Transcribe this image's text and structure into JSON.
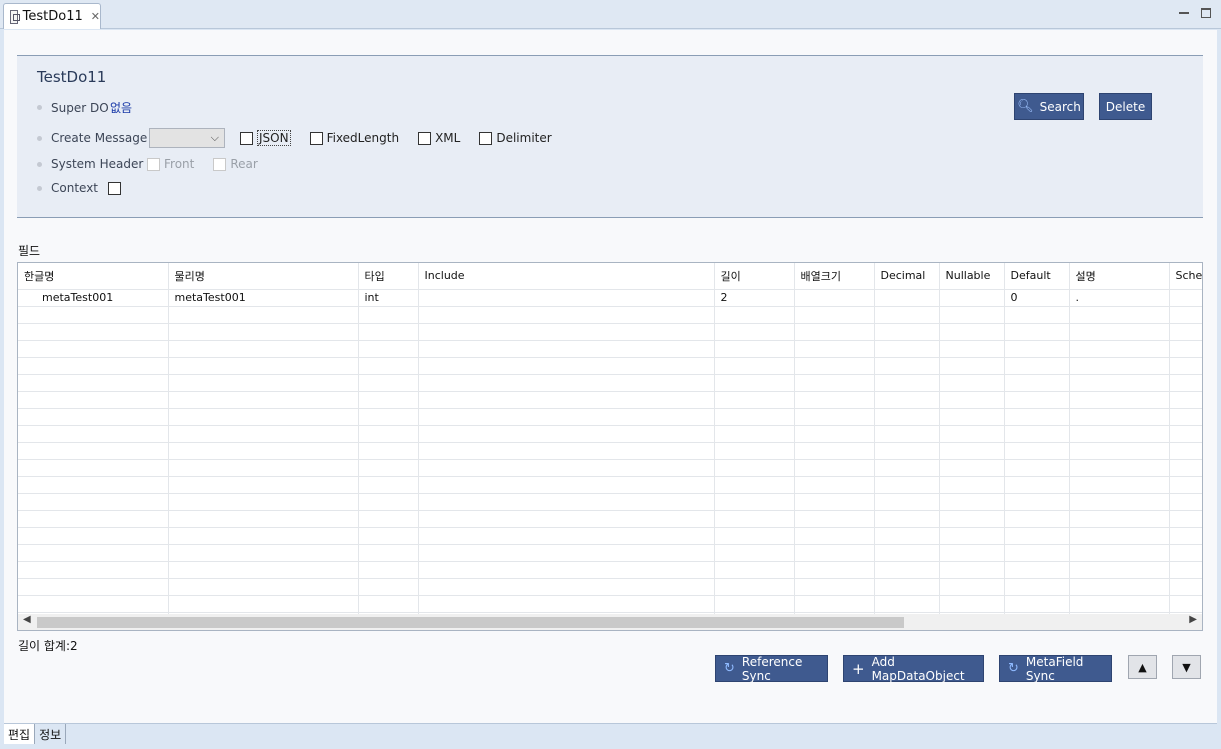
{
  "tab": {
    "title": "TestDo11",
    "close": "✕"
  },
  "form": {
    "title": "TestDo11",
    "super_do_label": "Super DO",
    "super_do_value": "없음",
    "create_message_label": "Create Message",
    "create_message_value": "",
    "message_types": [
      {
        "label": "JSON",
        "checked": false
      },
      {
        "label": "FixedLength",
        "checked": false
      },
      {
        "label": "XML",
        "checked": false
      },
      {
        "label": "Delimiter",
        "checked": false
      }
    ],
    "system_header_label": "System Header",
    "system_header_options": [
      {
        "label": "Front",
        "checked": false,
        "disabled": true
      },
      {
        "label": "Rear",
        "checked": false,
        "disabled": true
      }
    ],
    "context_label": "Context",
    "search_label": "Search",
    "delete_label": "Delete"
  },
  "fields": {
    "section_label": "필드",
    "columns": [
      "한글명",
      "물리명",
      "타입",
      "Include",
      "길이",
      "배열크기",
      "Decimal",
      "Nullable",
      "Default",
      "설명",
      "Sche"
    ],
    "rows": [
      [
        "metaTest001",
        "metaTest001",
        "int",
        "",
        "2",
        "",
        "",
        "",
        "0",
        ".",
        ""
      ]
    ],
    "total_label": "길이 합계:2"
  },
  "actions": {
    "reference_sync": "Reference Sync",
    "add_map": "Add MapDataObject",
    "metafield_sync": "MetaField Sync",
    "up": "▲",
    "down": "▼"
  },
  "bottom_tabs": [
    "편집",
    "정보"
  ],
  "colors": {
    "button_bg": "#3f5a8f",
    "link": "#1a3aa8",
    "panel_bg": "#e8edf5"
  }
}
